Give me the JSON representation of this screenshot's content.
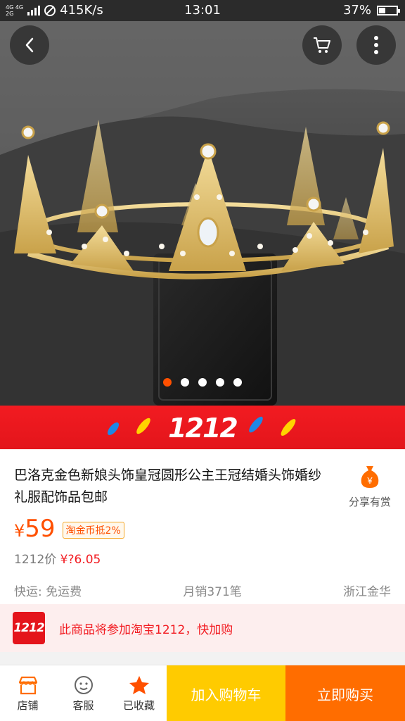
{
  "status_bar": {
    "network_label": "4G 4G\n2G",
    "speed": "415K/s",
    "time": "13:01",
    "battery": "37%",
    "battery_level": 0.37
  },
  "gallery": {
    "image_count": 5,
    "active_index": 0
  },
  "banner": {
    "logo_text": "1212"
  },
  "product": {
    "title": "巴洛克金色新娘头饰皇冠圆形公主王冠结婚头饰婚纱礼服配饰品包邮",
    "share_label": "分享有赏",
    "currency": "¥",
    "price": "59",
    "coin_tag": "淘金币抵2%",
    "orig_label": "1212价",
    "orig_price": "¥?6.05",
    "shipping": "快运: 免运费",
    "monthly_sales": "月销371笔",
    "location": "浙江金华"
  },
  "promo": {
    "badge": "1212",
    "text": "此商品将参加淘宝1212，快加购"
  },
  "bottom_bar": {
    "shop_label": "店铺",
    "service_label": "客服",
    "favorite_label": "已收藏",
    "add_cart_label": "加入购物车",
    "buy_now_label": "立即购买"
  },
  "colors": {
    "accent_orange": "#ff5000",
    "banner_red": "#e3151b",
    "cart_yellow": "#ffcb00",
    "buy_orange": "#ff6d00"
  }
}
